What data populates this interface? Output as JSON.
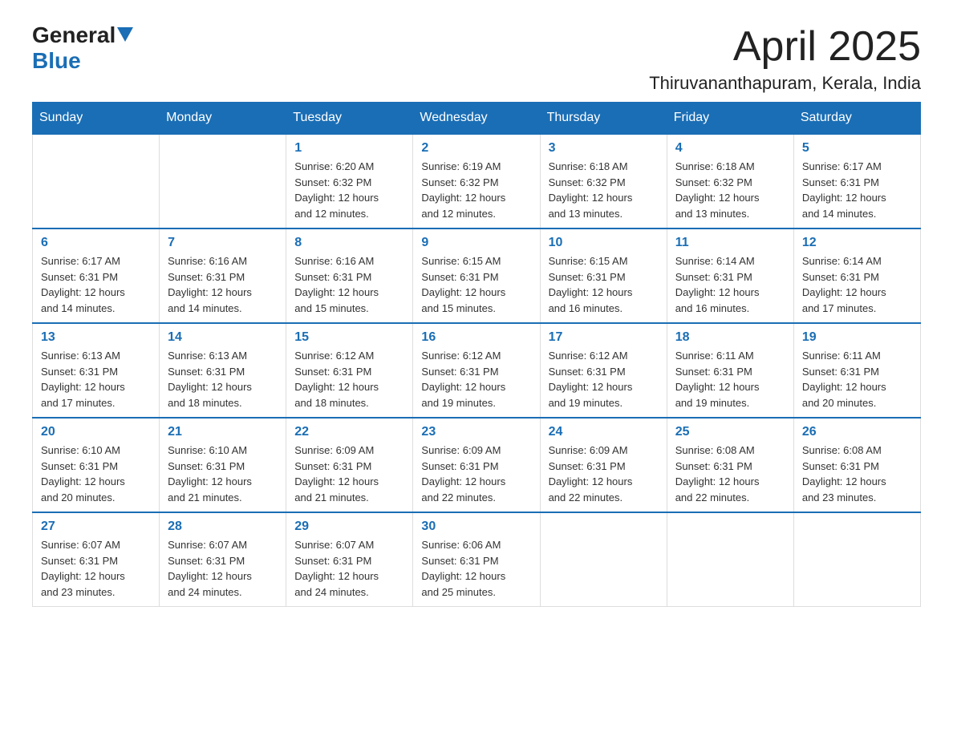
{
  "header": {
    "logo_general": "General",
    "logo_blue": "Blue",
    "title": "April 2025",
    "subtitle": "Thiruvananthapuram, Kerala, India"
  },
  "weekdays": [
    "Sunday",
    "Monday",
    "Tuesday",
    "Wednesday",
    "Thursday",
    "Friday",
    "Saturday"
  ],
  "weeks": [
    [
      {
        "day": "",
        "info": ""
      },
      {
        "day": "",
        "info": ""
      },
      {
        "day": "1",
        "info": "Sunrise: 6:20 AM\nSunset: 6:32 PM\nDaylight: 12 hours\nand 12 minutes."
      },
      {
        "day": "2",
        "info": "Sunrise: 6:19 AM\nSunset: 6:32 PM\nDaylight: 12 hours\nand 12 minutes."
      },
      {
        "day": "3",
        "info": "Sunrise: 6:18 AM\nSunset: 6:32 PM\nDaylight: 12 hours\nand 13 minutes."
      },
      {
        "day": "4",
        "info": "Sunrise: 6:18 AM\nSunset: 6:32 PM\nDaylight: 12 hours\nand 13 minutes."
      },
      {
        "day": "5",
        "info": "Sunrise: 6:17 AM\nSunset: 6:31 PM\nDaylight: 12 hours\nand 14 minutes."
      }
    ],
    [
      {
        "day": "6",
        "info": "Sunrise: 6:17 AM\nSunset: 6:31 PM\nDaylight: 12 hours\nand 14 minutes."
      },
      {
        "day": "7",
        "info": "Sunrise: 6:16 AM\nSunset: 6:31 PM\nDaylight: 12 hours\nand 14 minutes."
      },
      {
        "day": "8",
        "info": "Sunrise: 6:16 AM\nSunset: 6:31 PM\nDaylight: 12 hours\nand 15 minutes."
      },
      {
        "day": "9",
        "info": "Sunrise: 6:15 AM\nSunset: 6:31 PM\nDaylight: 12 hours\nand 15 minutes."
      },
      {
        "day": "10",
        "info": "Sunrise: 6:15 AM\nSunset: 6:31 PM\nDaylight: 12 hours\nand 16 minutes."
      },
      {
        "day": "11",
        "info": "Sunrise: 6:14 AM\nSunset: 6:31 PM\nDaylight: 12 hours\nand 16 minutes."
      },
      {
        "day": "12",
        "info": "Sunrise: 6:14 AM\nSunset: 6:31 PM\nDaylight: 12 hours\nand 17 minutes."
      }
    ],
    [
      {
        "day": "13",
        "info": "Sunrise: 6:13 AM\nSunset: 6:31 PM\nDaylight: 12 hours\nand 17 minutes."
      },
      {
        "day": "14",
        "info": "Sunrise: 6:13 AM\nSunset: 6:31 PM\nDaylight: 12 hours\nand 18 minutes."
      },
      {
        "day": "15",
        "info": "Sunrise: 6:12 AM\nSunset: 6:31 PM\nDaylight: 12 hours\nand 18 minutes."
      },
      {
        "day": "16",
        "info": "Sunrise: 6:12 AM\nSunset: 6:31 PM\nDaylight: 12 hours\nand 19 minutes."
      },
      {
        "day": "17",
        "info": "Sunrise: 6:12 AM\nSunset: 6:31 PM\nDaylight: 12 hours\nand 19 minutes."
      },
      {
        "day": "18",
        "info": "Sunrise: 6:11 AM\nSunset: 6:31 PM\nDaylight: 12 hours\nand 19 minutes."
      },
      {
        "day": "19",
        "info": "Sunrise: 6:11 AM\nSunset: 6:31 PM\nDaylight: 12 hours\nand 20 minutes."
      }
    ],
    [
      {
        "day": "20",
        "info": "Sunrise: 6:10 AM\nSunset: 6:31 PM\nDaylight: 12 hours\nand 20 minutes."
      },
      {
        "day": "21",
        "info": "Sunrise: 6:10 AM\nSunset: 6:31 PM\nDaylight: 12 hours\nand 21 minutes."
      },
      {
        "day": "22",
        "info": "Sunrise: 6:09 AM\nSunset: 6:31 PM\nDaylight: 12 hours\nand 21 minutes."
      },
      {
        "day": "23",
        "info": "Sunrise: 6:09 AM\nSunset: 6:31 PM\nDaylight: 12 hours\nand 22 minutes."
      },
      {
        "day": "24",
        "info": "Sunrise: 6:09 AM\nSunset: 6:31 PM\nDaylight: 12 hours\nand 22 minutes."
      },
      {
        "day": "25",
        "info": "Sunrise: 6:08 AM\nSunset: 6:31 PM\nDaylight: 12 hours\nand 22 minutes."
      },
      {
        "day": "26",
        "info": "Sunrise: 6:08 AM\nSunset: 6:31 PM\nDaylight: 12 hours\nand 23 minutes."
      }
    ],
    [
      {
        "day": "27",
        "info": "Sunrise: 6:07 AM\nSunset: 6:31 PM\nDaylight: 12 hours\nand 23 minutes."
      },
      {
        "day": "28",
        "info": "Sunrise: 6:07 AM\nSunset: 6:31 PM\nDaylight: 12 hours\nand 24 minutes."
      },
      {
        "day": "29",
        "info": "Sunrise: 6:07 AM\nSunset: 6:31 PM\nDaylight: 12 hours\nand 24 minutes."
      },
      {
        "day": "30",
        "info": "Sunrise: 6:06 AM\nSunset: 6:31 PM\nDaylight: 12 hours\nand 25 minutes."
      },
      {
        "day": "",
        "info": ""
      },
      {
        "day": "",
        "info": ""
      },
      {
        "day": "",
        "info": ""
      }
    ]
  ]
}
